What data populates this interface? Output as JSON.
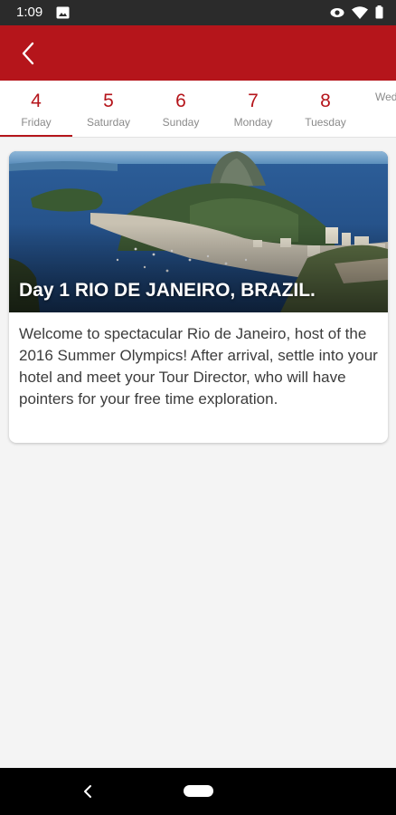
{
  "status": {
    "time": "1:09"
  },
  "colors": {
    "brand": "#b5151b",
    "accent_text": "#b5151b"
  },
  "tabs": [
    {
      "num": "4",
      "day": "Friday",
      "active": true
    },
    {
      "num": "5",
      "day": "Saturday"
    },
    {
      "num": "6",
      "day": "Sunday"
    },
    {
      "num": "7",
      "day": "Monday"
    },
    {
      "num": "8",
      "day": "Tuesday"
    },
    {
      "num": "",
      "day": "Wed"
    }
  ],
  "card": {
    "title": "Day 1 RIO DE JANEIRO, BRAZIL.",
    "body": "Welcome to spectacular Rio de Janeiro, host of the 2016 Summer Olympics! After arrival, settle into your hotel and meet your Tour Director, who will have pointers for your free time exploration."
  }
}
